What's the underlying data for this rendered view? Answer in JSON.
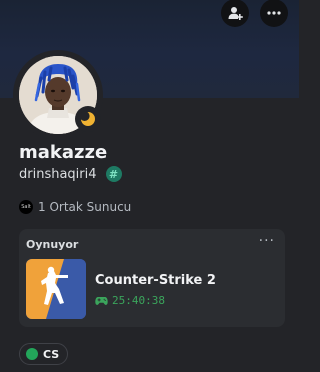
{
  "profile": {
    "display_name": "makazze",
    "username": "drinshaqiri4",
    "badge_symbol": "#",
    "status": "idle",
    "mutual_servers_text": "1 Ortak Sunucu",
    "mutual_server_icon_text": "Salt"
  },
  "activity": {
    "heading": "Oynuyor",
    "more": "···",
    "game_name": "Counter-Strike 2",
    "elapsed": "25:40:38"
  },
  "tags": [
    {
      "label": "CS",
      "color": "#23a55a"
    }
  ],
  "icons": {
    "add_friend": "add-friend-icon",
    "more": "more-icon",
    "status": "moon-icon",
    "controller": "gamepad-icon"
  },
  "colors": {
    "background": "#232428",
    "card": "#2b2d31",
    "status_idle": "#f0b232",
    "online_green": "#23a55a",
    "badge_teal": "#1e7a63"
  }
}
